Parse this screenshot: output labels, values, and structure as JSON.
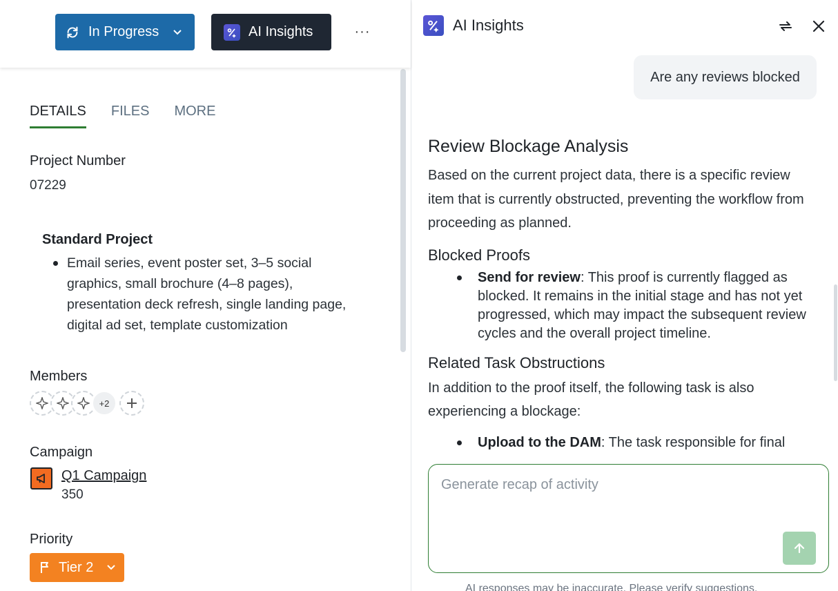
{
  "header": {
    "status_label": "In Progress",
    "ai_button_label": "AI Insights",
    "more_label": "···"
  },
  "tabs": [
    {
      "label": "DETAILS",
      "active": true
    },
    {
      "label": "FILES",
      "active": false
    },
    {
      "label": "MORE",
      "active": false
    }
  ],
  "details": {
    "project_number_label": "Project Number",
    "project_number": "07229",
    "standard_title": "Standard Project",
    "standard_items": "Email series, event poster set, 3–5 social graphics, small brochure (4–8 pages), presentation deck refresh, single landing page, digital ad set, template customization",
    "members_label": "Members",
    "members_more": "+2",
    "campaign_label": "Campaign",
    "campaign_name": "Q1 Campaign",
    "campaign_number": "350",
    "priority_label": "Priority",
    "priority_value": "Tier 2"
  },
  "ai_panel": {
    "title": "AI Insights",
    "user_message": "Are any reviews blocked",
    "response": {
      "heading": "Review Blockage Analysis",
      "intro": "Based on the current project data, there is a specific review item that is currently obstructed, preventing the workflow from proceeding as planned.",
      "section1_title": "Blocked Proofs",
      "item1_bold": "Send for review",
      "item1_text": ": This proof is currently flagged as blocked. It remains in the initial stage and has not yet progressed, which may impact the subsequent review cycles and the overall project timeline.",
      "section2_title": "Related Task Obstructions",
      "section2_intro": "In addition to the proof itself, the following task is also experiencing a blockage:",
      "item2_bold": "Upload to the DAM",
      "item2_text": ": The task responsible for final"
    },
    "input_placeholder": "Generate recap of activity",
    "disclaimer": "AI responses may be inaccurate. Please verify suggestions."
  },
  "colors": {
    "status_button": "#1d6aa8",
    "ai_button": "#1f2733",
    "priority_button": "#f38221",
    "campaign_icon": "#f26b21",
    "active_tab_underline": "#2e7d32",
    "send_button": "#a4d3b0"
  },
  "icons": {
    "status": "progress-cycle-icon",
    "ai": "ai-sparkle-logo-icon",
    "campaign": "megaphone-icon",
    "priority": "flag-icon",
    "swap": "swap-arrows-icon",
    "close": "close-icon",
    "send": "arrow-up-icon",
    "member": "sparkle-avatar-icon",
    "add": "plus-icon"
  }
}
